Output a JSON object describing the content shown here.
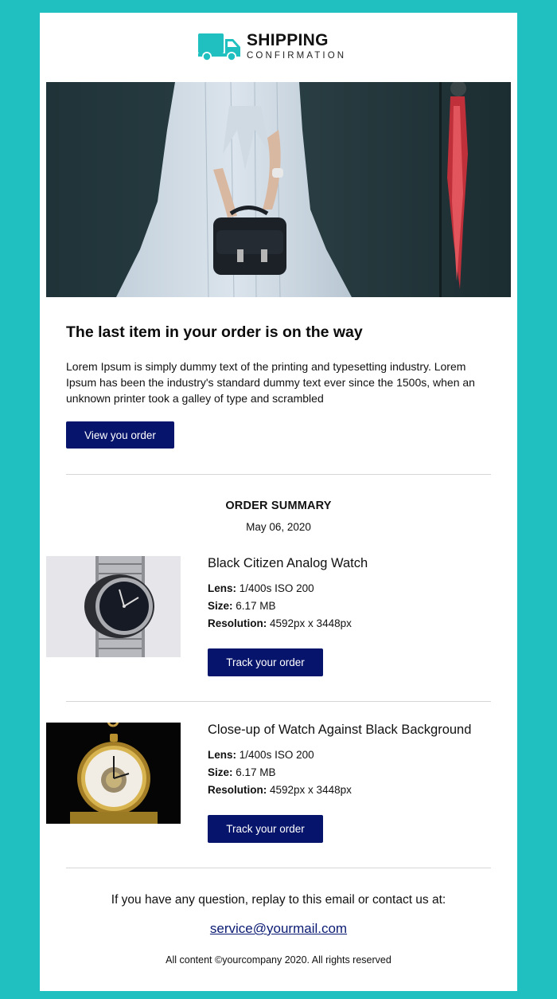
{
  "brand": {
    "title": "SHIPPING",
    "subtitle": "CONFIRMATION",
    "icon": "truck-icon"
  },
  "colors": {
    "background": "#1fc0bf",
    "button": "#06146b",
    "link": "#0a1a73"
  },
  "intro": {
    "heading": "The last item in your order is on the way",
    "body": "Lorem Ipsum is simply dummy text of the printing and typesetting industry. Lorem Ipsum has been the industry's standard dummy text ever since the 1500s, when an unknown printer took a galley of type and scrambled",
    "button_label": "View you order"
  },
  "summary": {
    "title": "ORDER SUMMARY",
    "date": "May 06, 2020"
  },
  "products": [
    {
      "name": "Black Citizen Analog Watch",
      "lens_label": "Lens:",
      "lens": "1/400s ISO 200",
      "size_label": "Size:",
      "size": "6.17 MB",
      "resolution_label": "Resolution:",
      "resolution": "4592px x 3448px",
      "button_label": "Track your order"
    },
    {
      "name": "Close-up of Watch Against Black Background",
      "lens_label": "Lens:",
      "lens": "1/400s ISO 200",
      "size_label": "Size:",
      "size": "6.17 MB",
      "resolution_label": "Resolution:",
      "resolution": "4592px x 3448px",
      "button_label": "Track your order"
    }
  ],
  "footer": {
    "question": "If you have any question, replay to this email or contact us at:",
    "email": "service@yourmail.com",
    "copyright": "All content ©yourcompany 2020. All rights reserved"
  }
}
